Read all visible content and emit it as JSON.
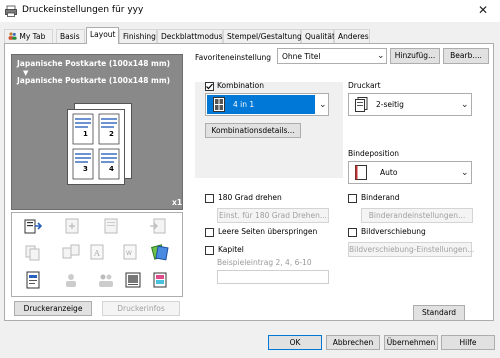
{
  "window": {
    "title": "Druckeinstellungen für yyy",
    "close_label": "✕"
  },
  "tabs": [
    "My Tab",
    "Basis",
    "Layout",
    "Finishing",
    "Deckblattmodus",
    "Stempel/Gestaltung",
    "Qualität",
    "Anderes"
  ],
  "active_tab": "Layout",
  "preview": {
    "paper_line1": "Japanische Postkarte (100x148 mm)",
    "arrow": "▼",
    "paper_line2": "Japanische Postkarte (100x148 mm)",
    "copies": "x1",
    "page_numbers": [
      "1",
      "2",
      "3",
      "4"
    ]
  },
  "left_buttons": {
    "printer_display": "Druckeranzeige",
    "printer_info": "Druckerinfos"
  },
  "favorites": {
    "label": "Favoriteneinstellung",
    "value": "Ohne Titel",
    "add": "Hinzufüg...",
    "edit": "Bearb...."
  },
  "combination": {
    "label": "Kombination",
    "checked": true,
    "value": "4 in 1",
    "details": "Kombinationsdetails..."
  },
  "print_type": {
    "label": "Druckart",
    "value": "2-seitig"
  },
  "binding_position": {
    "label": "Bindeposition",
    "value": "Auto"
  },
  "rotate180": {
    "label": "180 Grad drehen",
    "checked": false,
    "settings": "Einst. für 180 Grad Drehen..."
  },
  "binding_margin": {
    "label": "Binderand",
    "checked": false,
    "settings": "Binderandeinstellungen..."
  },
  "skip_blank": {
    "label": "Leere Seiten überspringen",
    "checked": false
  },
  "image_shift": {
    "label": "Bildverschiebung",
    "checked": false,
    "settings": "Bildverschiebung-Einstellungen..."
  },
  "chapter": {
    "label": "Kapitel",
    "checked": false,
    "placeholder": "Beispieleintrag 2, 4, 6-10",
    "value": ""
  },
  "standard_button": "Standard",
  "footer": {
    "ok": "OK",
    "cancel": "Abbrechen",
    "apply": "Übernehmen",
    "help": "Hilfe"
  },
  "colors": {
    "selection": "#0078d7",
    "panel_dark": "#898989"
  }
}
